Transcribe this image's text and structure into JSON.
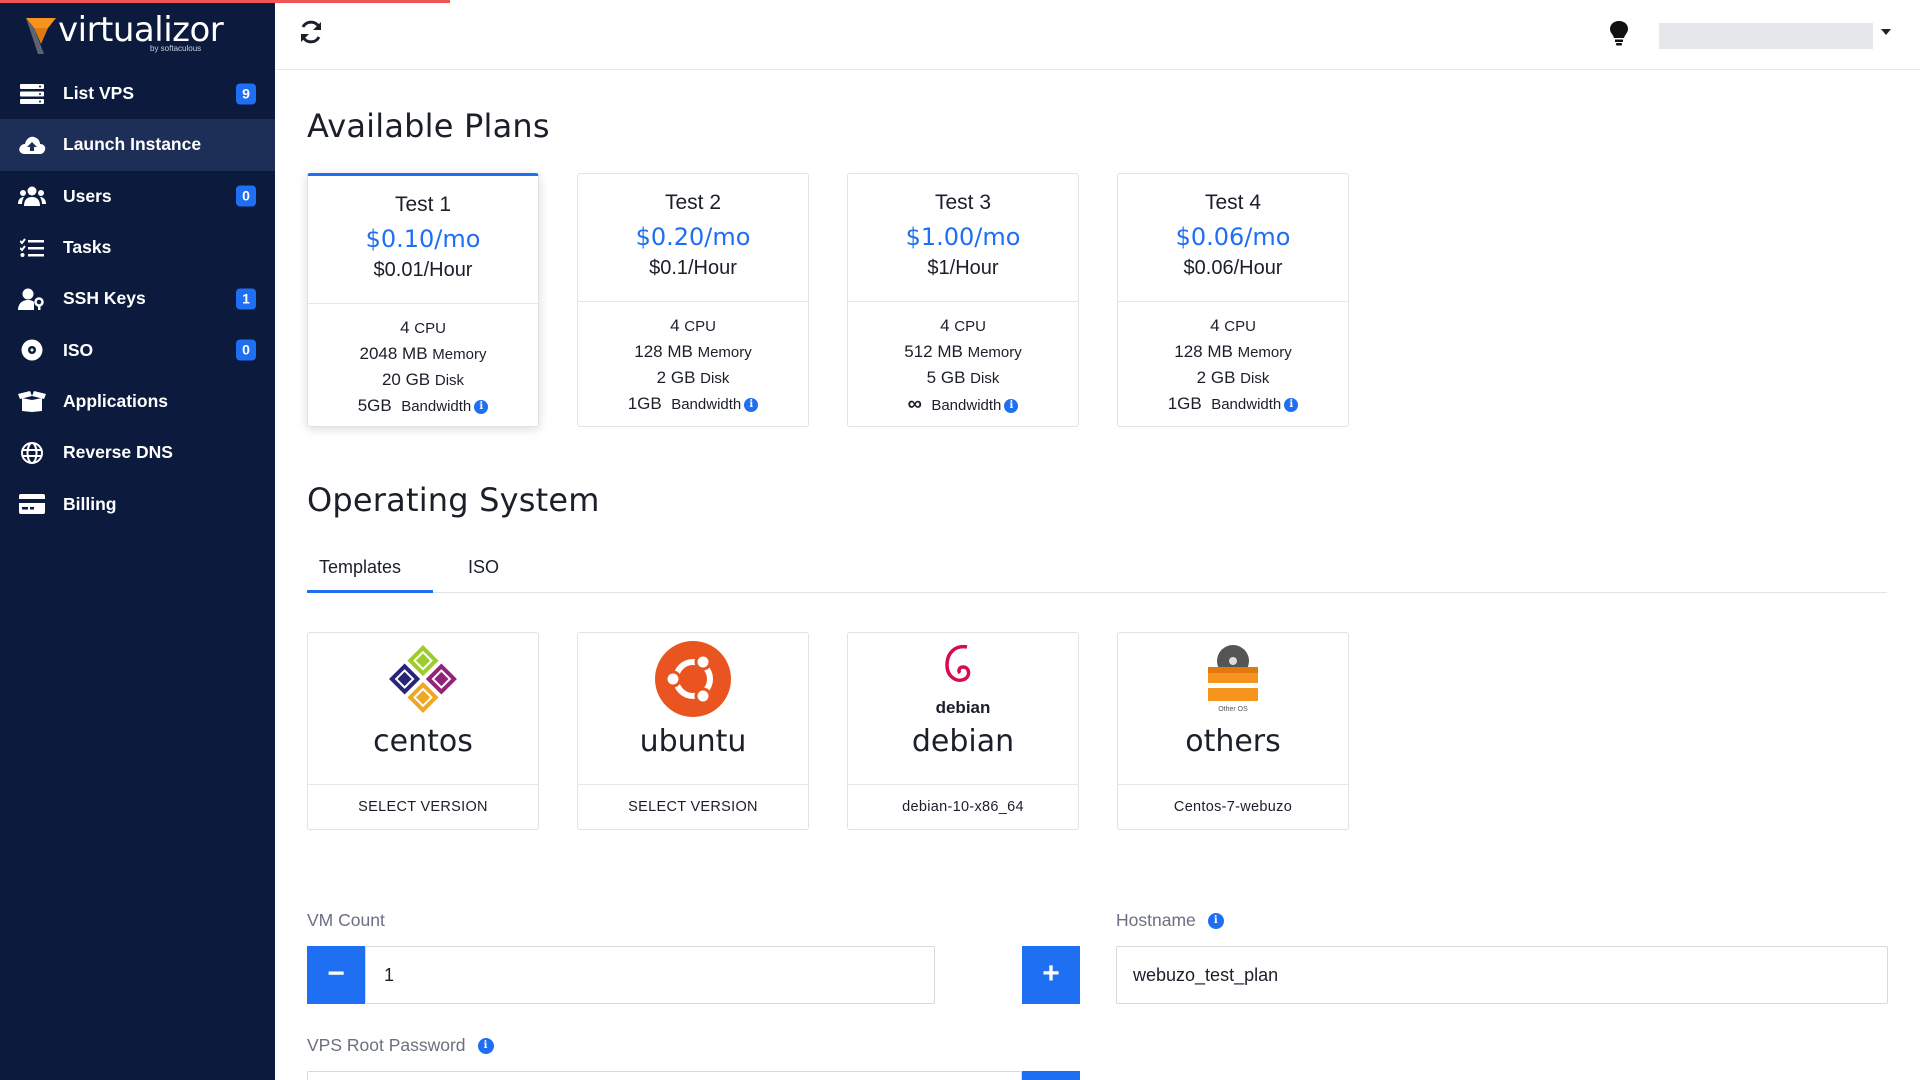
{
  "brand": {
    "name": "virtualizor",
    "sub": "by softaculous"
  },
  "sidebar": {
    "items": [
      {
        "label": "List VPS",
        "icon": "server-icon",
        "badge": "9"
      },
      {
        "label": "Launch Instance",
        "icon": "cloud-upload-icon",
        "badge": ""
      },
      {
        "label": "Users",
        "icon": "users-icon",
        "badge": "0"
      },
      {
        "label": "Tasks",
        "icon": "tasks-icon",
        "badge": ""
      },
      {
        "label": "SSH Keys",
        "icon": "user-key-icon",
        "badge": "1"
      },
      {
        "label": "ISO",
        "icon": "disc-icon",
        "badge": "0"
      },
      {
        "label": "Applications",
        "icon": "box-open-icon",
        "badge": ""
      },
      {
        "label": "Reverse DNS",
        "icon": "globe-icon",
        "badge": ""
      },
      {
        "label": "Billing",
        "icon": "credit-card-icon",
        "badge": ""
      }
    ]
  },
  "main": {
    "plans_title": "Available Plans",
    "plans": [
      {
        "name": "Test 1",
        "price": "$0.10/mo",
        "hourly": "$0.01/Hour",
        "cpu": "4",
        "cpu_unit": "CPU",
        "memory": "2048 MB",
        "memory_unit": "Memory",
        "disk": "20 GB",
        "disk_unit": "Disk",
        "bandwidth": "5GB",
        "bandwidth_unit": "Bandwidth"
      },
      {
        "name": "Test 2",
        "price": "$0.20/mo",
        "hourly": "$0.1/Hour",
        "cpu": "4",
        "cpu_unit": "CPU",
        "memory": "128 MB",
        "memory_unit": "Memory",
        "disk": "2 GB",
        "disk_unit": "Disk",
        "bandwidth": "1GB",
        "bandwidth_unit": "Bandwidth"
      },
      {
        "name": "Test 3",
        "price": "$1.00/mo",
        "hourly": "$1/Hour",
        "cpu": "4",
        "cpu_unit": "CPU",
        "memory": "512 MB",
        "memory_unit": "Memory",
        "disk": "5 GB",
        "disk_unit": "Disk",
        "bandwidth": "∞",
        "bandwidth_unit": "Bandwidth"
      },
      {
        "name": "Test 4",
        "price": "$0.06/mo",
        "hourly": "$0.06/Hour",
        "cpu": "4",
        "cpu_unit": "CPU",
        "memory": "128 MB",
        "memory_unit": "Memory",
        "disk": "2 GB",
        "disk_unit": "Disk",
        "bandwidth": "1GB",
        "bandwidth_unit": "Bandwidth"
      }
    ],
    "os_title": "Operating System",
    "tabs": [
      {
        "label": "Templates"
      },
      {
        "label": "ISO"
      }
    ],
    "os": [
      {
        "name": "centos",
        "version": "SELECT VERSION",
        "logo": "centos-logo"
      },
      {
        "name": "ubuntu",
        "version": "SELECT VERSION",
        "logo": "ubuntu-logo"
      },
      {
        "name": "debian",
        "version": "debian-10-x86_64",
        "logo": "debian-logo",
        "logo_text": "debian"
      },
      {
        "name": "others",
        "version": "Centos-7-webuzo",
        "logo": "others-logo",
        "logo_text": "Other OS"
      }
    ],
    "vm_count": {
      "label": "VM Count",
      "value": "1",
      "minus": "−",
      "plus": "+"
    },
    "hostname": {
      "label": "Hostname",
      "value": "webuzo_test_plan"
    },
    "root_password": {
      "label": "VPS Root Password"
    }
  },
  "colors": {
    "accent": "#1f6ff3",
    "sidebar": "#0c1a3d",
    "sidebar_active": "#1d2e57",
    "progress": "#f05454"
  }
}
